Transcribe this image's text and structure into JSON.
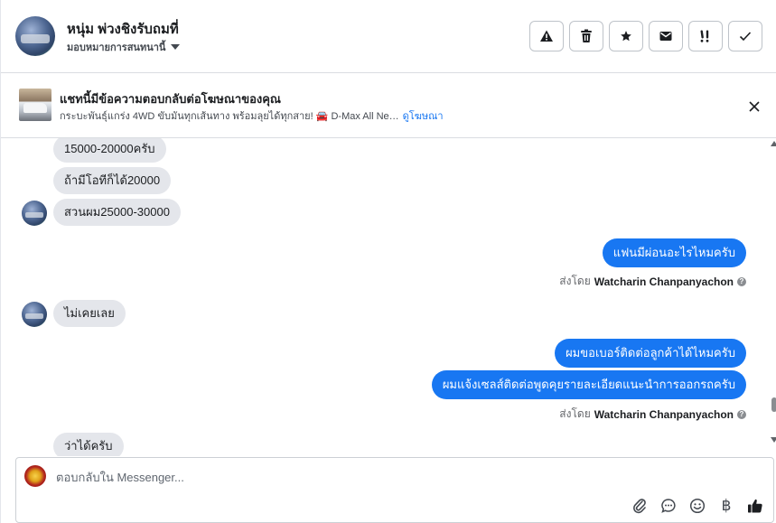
{
  "header": {
    "contact_name": "หนุ่ม พ่วงชิงรับถมที่",
    "assign_label": "มอบหมายการสนทนานี้",
    "actions": {
      "spam": "spam-icon",
      "delete": "trash-icon",
      "star": "star-icon",
      "unread": "mail-icon",
      "follow_up": "follow-up-icon",
      "done": "check-icon"
    }
  },
  "ad": {
    "title": "แชทนี้มีข้อความตอบกลับต่อโฆษณาของคุณ",
    "description": "กระบะพันธุ์แกร่ง 4WD ขับมันทุกเส้นทาง พร้อมลุยได้ทุกสาย! 🚘 D-Max All Ne…",
    "link": "ดูโฆษณา"
  },
  "messages": {
    "in_1": "15000-20000ครับ",
    "in_2": "ถ้ามีโอทีก็ได้20000",
    "in_3": "สวนผม25000-30000",
    "out_1": "แฟนมีผ่อนอะไรไหมครับ",
    "in_4": "ไม่เคยเลย",
    "out_2": "ผมขอเบอร์ติดต่อลูกค้าได้ไหมครับ",
    "out_3": "ผมแจ้งเซลส์ติดต่อพูดคุยรายละเอียดแนะนำการออกรถครับ",
    "in_5": "ว่าได้ครับ"
  },
  "sent_by": {
    "prefix": "ส่งโดย",
    "name": "Watcharin Chanpanyachon"
  },
  "composer": {
    "placeholder": "ตอบกลับใน Messenger...",
    "tools": [
      "attach-icon",
      "saved-reply-icon",
      "emoji-icon",
      "baht-icon",
      "like-icon"
    ],
    "baht_symbol": "฿"
  },
  "colors": {
    "accent": "#1877f2",
    "incoming_bubble": "#e4e6eb"
  }
}
